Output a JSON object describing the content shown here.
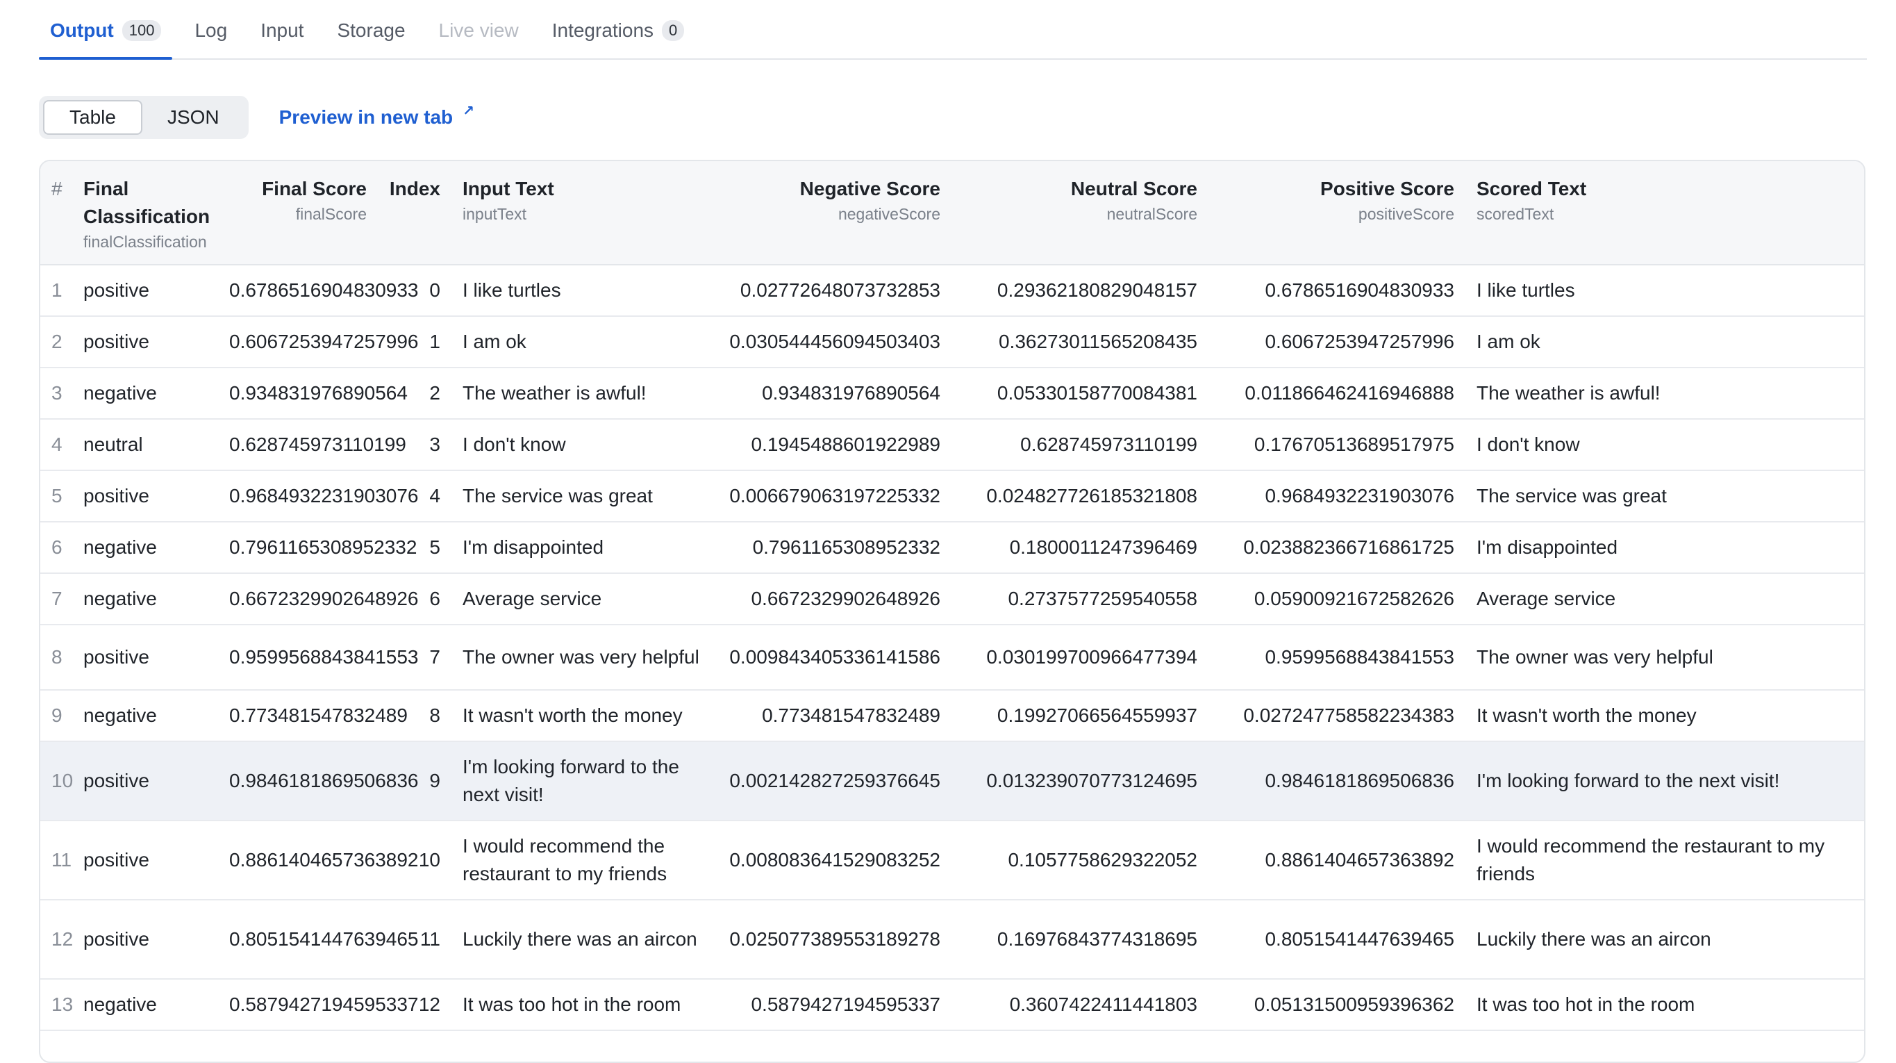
{
  "tabs": [
    {
      "label": "Output",
      "badge": "100"
    },
    {
      "label": "Log"
    },
    {
      "label": "Input"
    },
    {
      "label": "Storage"
    },
    {
      "label": "Live view"
    },
    {
      "label": "Integrations",
      "badge": "0"
    }
  ],
  "view_toggle": {
    "table": "Table",
    "json": "JSON"
  },
  "preview": {
    "label": "Preview in new tab",
    "icon": "external-link-icon"
  },
  "columns": {
    "hash": "#",
    "finalClassification": {
      "title": "Final Classification",
      "key": "finalClassification"
    },
    "finalScore": {
      "title": "Final Score",
      "key": "finalScore"
    },
    "index": {
      "title": "Index"
    },
    "inputText": {
      "title": "Input Text",
      "key": "inputText"
    },
    "negativeScore": {
      "title": "Negative Score",
      "key": "negativeScore"
    },
    "neutralScore": {
      "title": "Neutral Score",
      "key": "neutralScore"
    },
    "positiveScore": {
      "title": "Positive Score",
      "key": "positiveScore"
    },
    "scoredText": {
      "title": "Scored Text",
      "key": "scoredText"
    }
  },
  "rows": [
    {
      "n": "1",
      "cls": "positive",
      "final": "0.6786516904830933",
      "idx": "0",
      "input": "I like turtles",
      "neg": "0.02772648073732853",
      "neu": "0.29362180829048157",
      "pos": "0.6786516904830933",
      "scored": "I like turtles"
    },
    {
      "n": "2",
      "cls": "positive",
      "final": "0.6067253947257996",
      "idx": "1",
      "input": "I am ok",
      "neg": "0.030544456094503403",
      "neu": "0.36273011565208435",
      "pos": "0.6067253947257996",
      "scored": "I am ok"
    },
    {
      "n": "3",
      "cls": "negative",
      "final": "0.934831976890564",
      "idx": "2",
      "input": "The weather is awful!",
      "neg": "0.934831976890564",
      "neu": "0.05330158770084381",
      "pos": "0.011866462416946888",
      "scored": "The weather is awful!"
    },
    {
      "n": "4",
      "cls": "neutral",
      "final": "0.628745973110199",
      "idx": "3",
      "input": "I don't know",
      "neg": "0.1945488601922989",
      "neu": "0.628745973110199",
      "pos": "0.17670513689517975",
      "scored": "I don't know"
    },
    {
      "n": "5",
      "cls": "positive",
      "final": "0.9684932231903076",
      "idx": "4",
      "input": "The service was great",
      "neg": "0.006679063197225332",
      "neu": "0.024827726185321808",
      "pos": "0.9684932231903076",
      "scored": "The service was great"
    },
    {
      "n": "6",
      "cls": "negative",
      "final": "0.7961165308952332",
      "idx": "5",
      "input": "I'm disappointed",
      "neg": "0.7961165308952332",
      "neu": "0.1800011247396469",
      "pos": "0.023882366716861725",
      "scored": "I'm disappointed"
    },
    {
      "n": "7",
      "cls": "negative",
      "final": "0.6672329902648926",
      "idx": "6",
      "input": "Average service",
      "neg": "0.6672329902648926",
      "neu": "0.2737577259540558",
      "pos": "0.05900921672582626",
      "scored": "Average service"
    },
    {
      "n": "8",
      "cls": "positive",
      "final": "0.9599568843841553",
      "idx": "7",
      "input": "The owner was very helpful",
      "neg": "0.009843405336141586",
      "neu": "0.030199700966477394",
      "pos": "0.9599568843841553",
      "scored": "The owner was very helpful"
    },
    {
      "n": "9",
      "cls": "negative",
      "final": "0.773481547832489",
      "idx": "8",
      "input": "It wasn't worth the money",
      "neg": "0.773481547832489",
      "neu": "0.19927066564559937",
      "pos": "0.027247758582234383",
      "scored": "It wasn't worth the money"
    },
    {
      "n": "10",
      "cls": "positive",
      "final": "0.9846181869506836",
      "idx": "9",
      "input": "I'm looking forward to the next visit!",
      "neg": "0.002142827259376645",
      "neu": "0.013239070773124695",
      "pos": "0.9846181869506836",
      "scored": "I'm looking forward to the next visit!"
    },
    {
      "n": "11",
      "cls": "positive",
      "final": "0.8861404657363892",
      "idx": "10",
      "input": "I would recommend the restaurant to my friends",
      "neg": "0.008083641529083252",
      "neu": "0.1057758629322052",
      "pos": "0.8861404657363892",
      "scored": "I would recommend the restaurant to my friends"
    },
    {
      "n": "12",
      "cls": "positive",
      "final": "0.8051541447639465",
      "idx": "11",
      "input": "Luckily there was an aircon",
      "neg": "0.025077389553189278",
      "neu": "0.16976843774318695",
      "pos": "0.8051541447639465",
      "scored": "Luckily there was an aircon"
    },
    {
      "n": "13",
      "cls": "negative",
      "final": "0.5879427194595337",
      "idx": "12",
      "input": "It was too hot in the room",
      "neg": "0.5879427194595337",
      "neu": "0.3607422411441803",
      "pos": "0.05131500959396362",
      "scored": "It was too hot in the room"
    }
  ]
}
